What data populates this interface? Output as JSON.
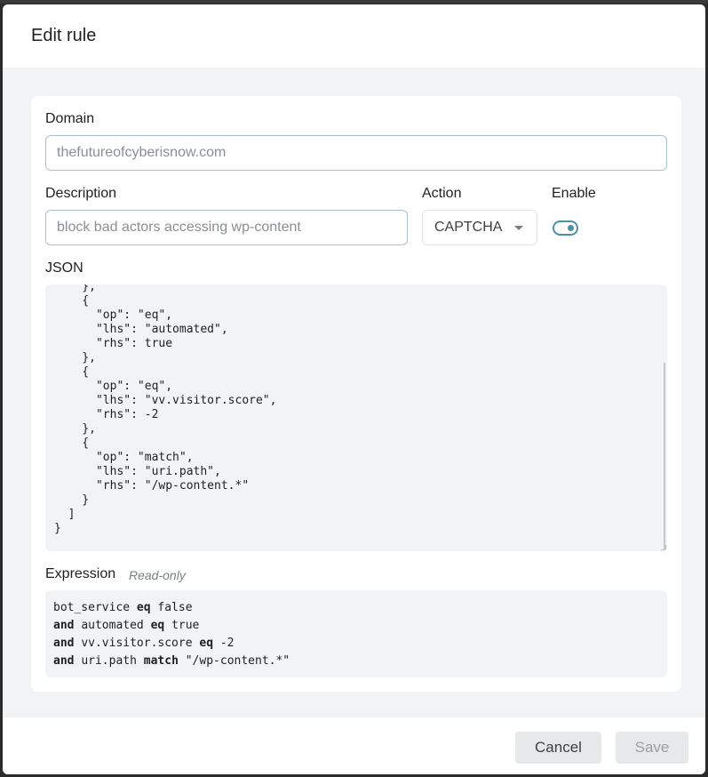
{
  "dialog": {
    "title": "Edit rule"
  },
  "domain": {
    "label": "Domain",
    "value": "thefutureofcyberisnow.com"
  },
  "description": {
    "label": "Description",
    "value": "block bad actors accessing wp-content"
  },
  "action": {
    "label": "Action",
    "value": "CAPTCHA"
  },
  "enable": {
    "label": "Enable",
    "checked": true
  },
  "json": {
    "label": "JSON",
    "content": "    },\n    {\n      \"op\": \"eq\",\n      \"lhs\": \"automated\",\n      \"rhs\": true\n    },\n    {\n      \"op\": \"eq\",\n      \"lhs\": \"vv.visitor.score\",\n      \"rhs\": -2\n    },\n    {\n      \"op\": \"match\",\n      \"lhs\": \"uri.path\",\n      \"rhs\": \"/wp-content.*\"\n    }\n  ]\n}"
  },
  "expression": {
    "label": "Expression",
    "readonly_label": "Read-only",
    "lines": [
      {
        "prefix": "",
        "lhs": "bot_service",
        "op": "eq",
        "rhs": "false"
      },
      {
        "prefix": "and",
        "lhs": "automated",
        "op": "eq",
        "rhs": "true"
      },
      {
        "prefix": "and",
        "lhs": "vv.visitor.score",
        "op": "eq",
        "rhs": "-2"
      },
      {
        "prefix": "and",
        "lhs": "uri.path",
        "op": "match",
        "rhs": "\"/wp-content.*\""
      }
    ]
  },
  "footer": {
    "cancel_label": "Cancel",
    "save_label": "Save"
  },
  "colors": {
    "accent": "#4a90ad",
    "panel_bg": "#f1f3f5"
  }
}
